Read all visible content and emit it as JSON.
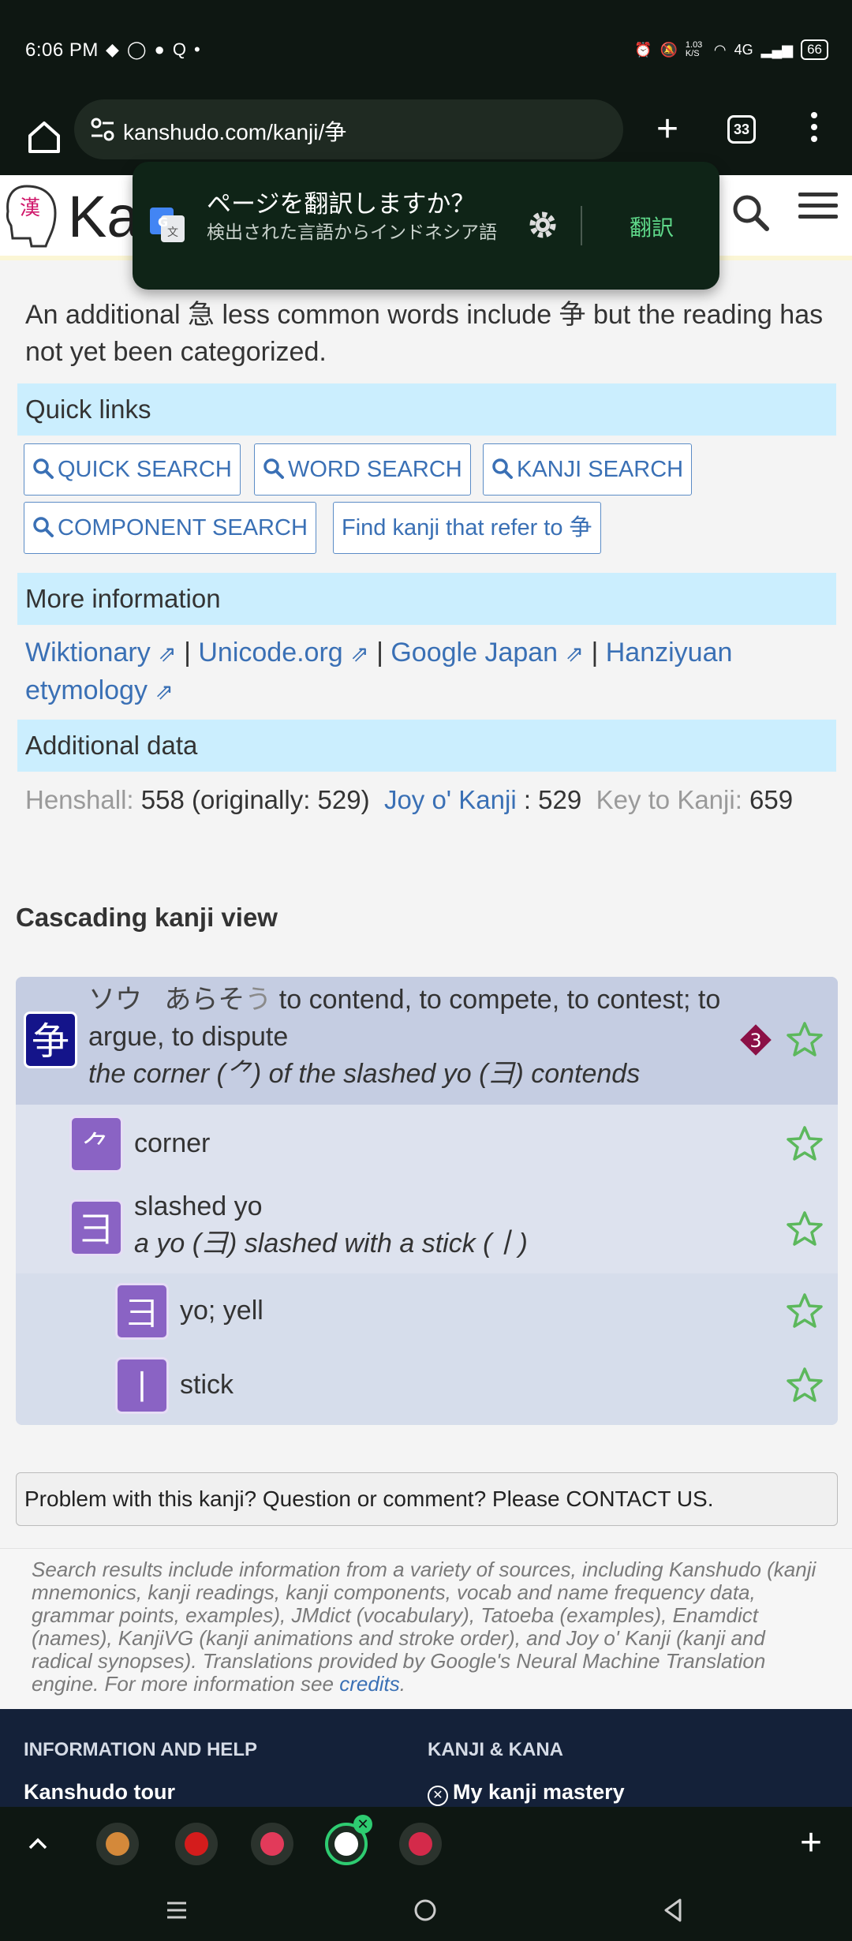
{
  "status_bar": {
    "time": "6:06 PM",
    "net_speed": "1.03 K/S",
    "network": "4G",
    "battery": "66"
  },
  "browser": {
    "url": "kanshudo.com/kanji/争",
    "tab_count": "33"
  },
  "site": {
    "logo_kanji": "漢",
    "logo_text": "Ka"
  },
  "translate_popup": {
    "title": "ページを翻訳しますか？",
    "subtitle": "検出された言語からインドネシア語",
    "action": "翻訳"
  },
  "intro_text": "An additional 急 less common words include 争 but the reading has not yet been categorized.",
  "quick_links": {
    "header": "Quick links",
    "buttons": [
      "QUICK SEARCH",
      "WORD SEARCH",
      "KANJI SEARCH",
      "COMPONENT SEARCH",
      "Find kanji that refer to 争"
    ]
  },
  "more_info": {
    "header": "More information",
    "links": [
      "Wiktionary",
      "Unicode.org",
      "Google Japan",
      "Hanziyuan etymology"
    ],
    "separator": " | ",
    "ext_mark": "⇗"
  },
  "additional_data": {
    "header": "Additional data",
    "henshall_label": "Henshall:",
    "henshall_value": "558 (originally: 529)",
    "joy_label": "Joy o' Kanji",
    "joy_value": ": 529",
    "key_label": "Key to Kanji:",
    "key_value": "659"
  },
  "cascade": {
    "title": "Cascading kanji view",
    "main": {
      "kanji": "争",
      "reading_on": "ソウ",
      "reading_kun": "あらそ",
      "reading_okurigana": "う",
      "meaning": "to contend, to compete, to contest; to argue, to dispute",
      "mnemonic": "the corner (⺈) of the slashed yo (⺕) contends",
      "badge": "3"
    },
    "components": [
      {
        "kanji": "⺈",
        "label": "corner",
        "desc": ""
      },
      {
        "kanji": "⺕",
        "label": "slashed yo",
        "desc": "a yo (彐) slashed with a stick (丨)"
      },
      {
        "kanji": "彐",
        "label": "yo; yell",
        "desc": ""
      },
      {
        "kanji": "丨",
        "label": "stick",
        "desc": ""
      }
    ]
  },
  "comment": "Problem with this kanji? Question or comment? Please CONTACT US.",
  "credits": {
    "text": "Search results include information from a variety of sources, including Kanshudo (kanji mnemonics, kanji readings, kanji components, vocab and name frequency data, grammar points, examples), JMdict (vocabulary), Tatoeba (examples), Enamdict (names), KanjiVG (kanji animations and stroke order), and Joy o' Kanji (kanji and radical synopses). Translations provided by Google's Neural Machine Translation engine. For more information see",
    "link": "credits",
    "end": "."
  },
  "footer": {
    "col1_header": "INFORMATION AND HELP",
    "col1_link": "Kanshudo tour",
    "col2_header": "KANJI & KANA",
    "col2_link": "My kanji mastery"
  },
  "colors": {
    "accent": "#3a70b5",
    "bar": "#cbeefe",
    "main_kanji": "#14148a",
    "component_kanji": "#8a63c4",
    "star": "#5cb85c",
    "badge": "#8b1046"
  }
}
